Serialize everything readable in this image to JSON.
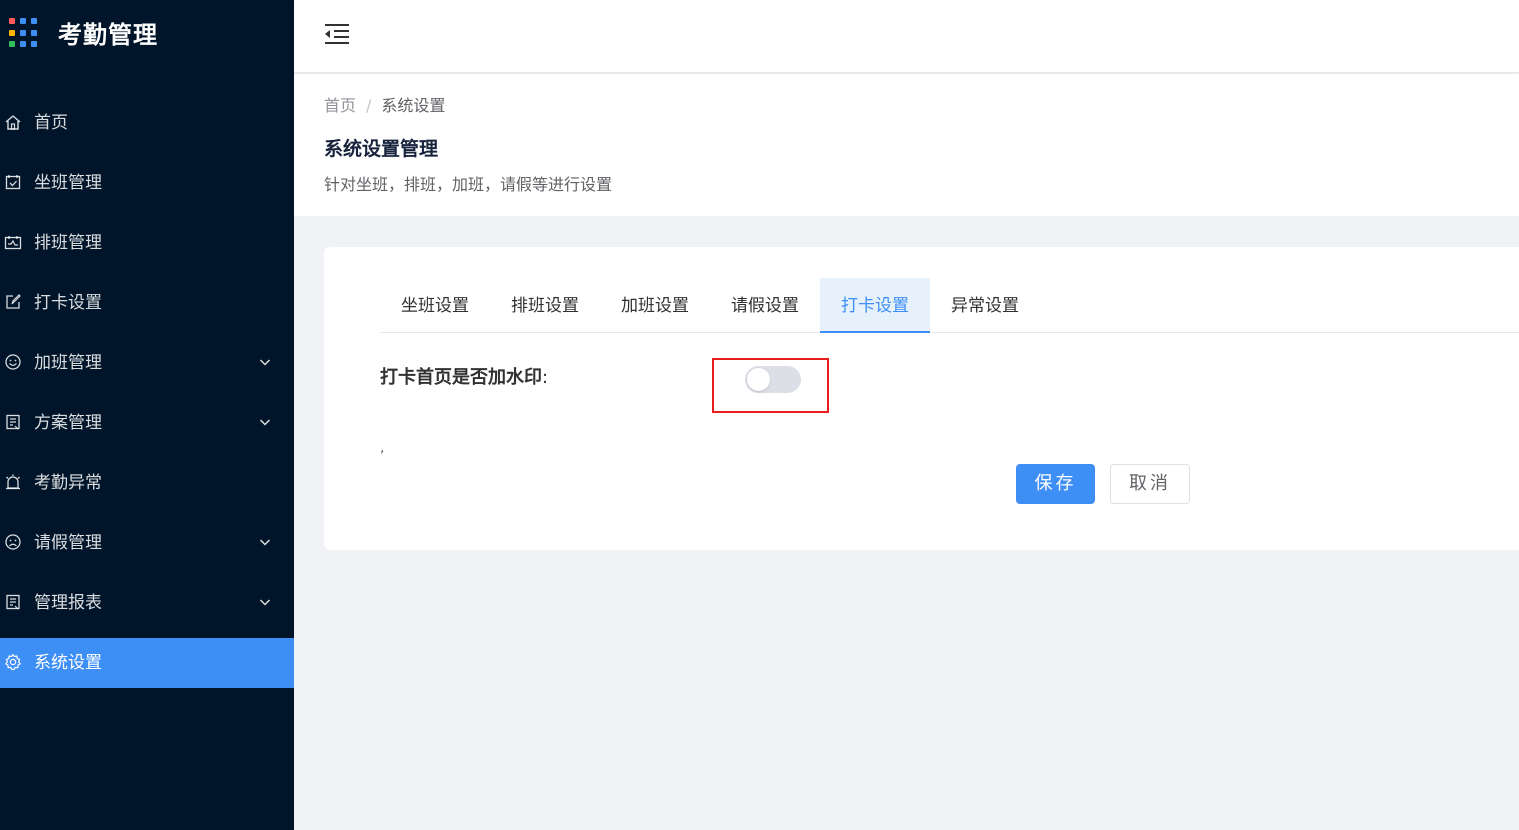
{
  "app": {
    "title": "考勤管理",
    "logo_icon": "app-grid-icon",
    "logo_colors": [
      "#ff5a5a",
      "#3d8ef5",
      "#3d8ef5",
      "#ffb400",
      "#3d8ef5",
      "#3d8ef5",
      "#2fbf5f",
      "#3d8ef5",
      "#3d8ef5"
    ]
  },
  "sidebar": {
    "items": [
      {
        "label": "首页",
        "icon": "home-icon",
        "has_submenu": false,
        "active": false
      },
      {
        "label": "坐班管理",
        "icon": "calendar-check-icon",
        "has_submenu": false,
        "active": false
      },
      {
        "label": "排班管理",
        "icon": "schedule-icon",
        "has_submenu": false,
        "active": false
      },
      {
        "label": "打卡设置",
        "icon": "edit-icon",
        "has_submenu": false,
        "active": false
      },
      {
        "label": "加班管理",
        "icon": "smile-icon",
        "has_submenu": true,
        "active": false
      },
      {
        "label": "方案管理",
        "icon": "document-icon",
        "has_submenu": true,
        "active": false
      },
      {
        "label": "考勤异常",
        "icon": "alarm-icon",
        "has_submenu": false,
        "active": false
      },
      {
        "label": "请假管理",
        "icon": "frown-icon",
        "has_submenu": true,
        "active": false
      },
      {
        "label": "管理报表",
        "icon": "report-icon",
        "has_submenu": true,
        "active": false
      },
      {
        "label": "系统设置",
        "icon": "gear-icon",
        "has_submenu": false,
        "active": true
      }
    ]
  },
  "header": {
    "fold_icon": "menu-fold-icon"
  },
  "breadcrumb": {
    "home": "首页",
    "separator": "/",
    "current": "系统设置"
  },
  "page": {
    "title": "系统设置管理",
    "description": "针对坐班，排班，加班，请假等进行设置"
  },
  "tabs": [
    {
      "label": "坐班设置",
      "active": false
    },
    {
      "label": "排班设置",
      "active": false
    },
    {
      "label": "加班设置",
      "active": false
    },
    {
      "label": "请假设置",
      "active": false
    },
    {
      "label": "打卡设置",
      "active": true
    },
    {
      "label": "异常设置",
      "active": false
    }
  ],
  "form": {
    "watermark_label": "打卡首页是否加水印",
    "colon": ":",
    "watermark_enabled": false,
    "stray_text": ","
  },
  "actions": {
    "save_label": "保存",
    "cancel_label": "取消"
  },
  "colors": {
    "sidebar_bg": "#001529",
    "accent": "#3d8ef5",
    "highlight_border": "#e81c1c"
  }
}
